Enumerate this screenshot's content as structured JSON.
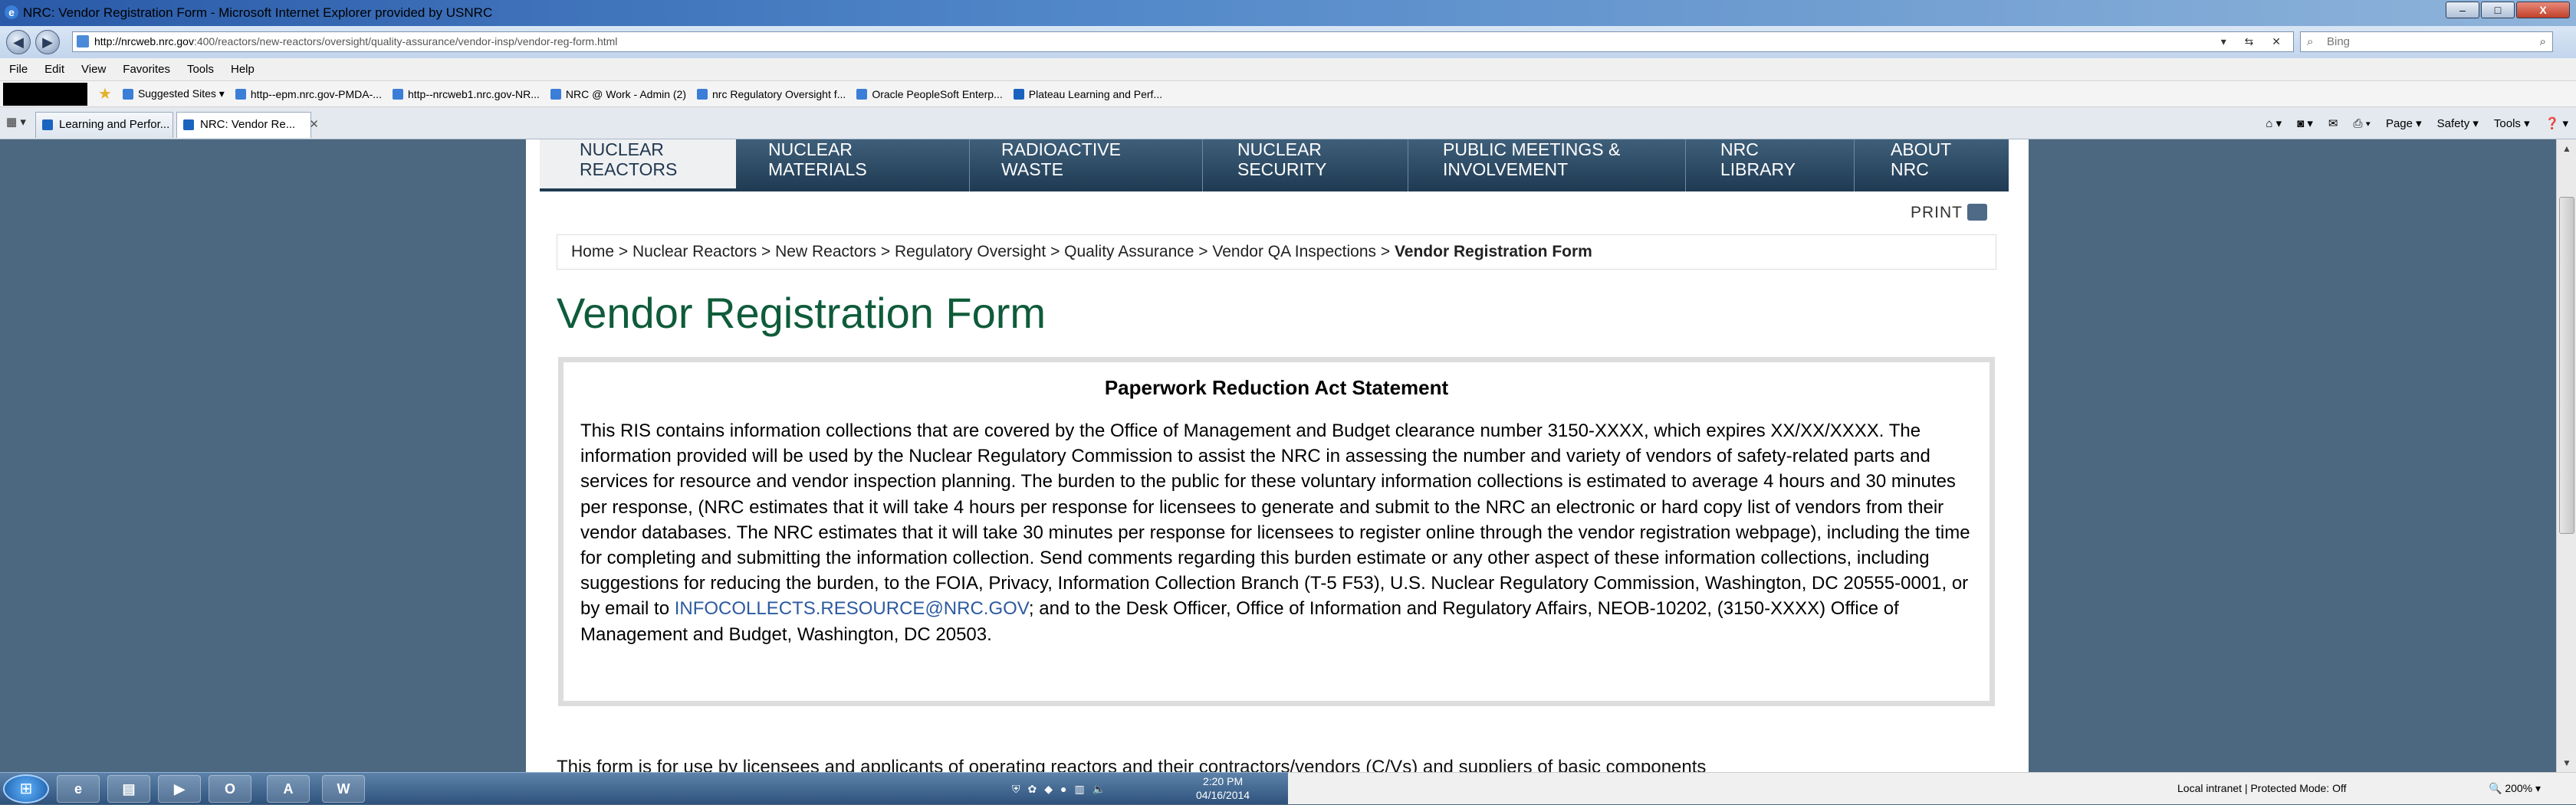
{
  "window": {
    "title": "NRC: Vendor Registration Form - Microsoft Internet Explorer provided by USNRC",
    "minimize": "–",
    "maximize": "□",
    "close": "X"
  },
  "address": {
    "host": "http://nrcweb.nrc.gov",
    "path": ":400/reactors/new-reactors/oversight/quality-assurance/vendor-insp/vendor-reg-form.html",
    "search_placeholder": "Bing"
  },
  "menu": [
    "File",
    "Edit",
    "View",
    "Favorites",
    "Tools",
    "Help"
  ],
  "favorites": [
    "Suggested Sites ▾",
    "http--epm.nrc.gov-PMDA-...",
    "http--nrcweb1.nrc.gov-NR...",
    "NRC @ Work - Admin (2)",
    "nrc Regulatory Oversight f...",
    "Oracle  PeopleSoft Enterp...",
    "Plateau Learning and Perf..."
  ],
  "tabs": [
    {
      "label": "Learning and Perfor..."
    },
    {
      "label": "NRC: Vendor Re...",
      "close": "✕"
    }
  ],
  "commandbar": [
    "Page ▾",
    "Safety ▾",
    "Tools ▾"
  ],
  "site_nav": [
    {
      "line1": "NUCLEAR",
      "line2": "REACTORS"
    },
    {
      "line1": "NUCLEAR",
      "line2": "MATERIALS"
    },
    {
      "line1": "RADIOACTIVE",
      "line2": "WASTE"
    },
    {
      "line1": "NUCLEAR",
      "line2": "SECURITY"
    },
    {
      "line1": "PUBLIC MEETINGS &",
      "line2": "INVOLVEMENT"
    },
    {
      "line1": "NRC",
      "line2": "LIBRARY"
    },
    {
      "line1": "ABOUT",
      "line2": "NRC"
    }
  ],
  "print_label": "PRINT",
  "breadcrumb": {
    "items": [
      "Home",
      "Nuclear Reactors",
      "New Reactors",
      "Regulatory Oversight",
      "Quality Assurance",
      "Vendor QA Inspections"
    ],
    "current": "Vendor Registration Form"
  },
  "page_title": "Vendor Registration Form",
  "pra": {
    "title": "Paperwork Reduction Act Statement",
    "body_before_link": "This RIS contains information collections that are covered by the Office of Management and Budget clearance number 3150-XXXX, which expires XX/XX/XXXX. The information provided will be used by the Nuclear Regulatory Commission to assist the NRC in assessing the number and variety of vendors of safety-related parts and services for resource and vendor inspection planning. The burden to the public for these voluntary information collections is estimated to average 4 hours and 30 minutes per response, (NRC estimates that it will take 4 hours per response for licensees to generate and submit to the NRC an electronic or hard copy list of vendors from their vendor databases. The NRC estimates that it will take 30 minutes per response for licensees to register online through the vendor registration webpage), including the time for completing and submitting the information collection. Send comments regarding this burden estimate or any other aspect of these information collections, including suggestions for reducing the burden, to the FOIA, Privacy, Information Collection Branch (T-5 F53), U.S. Nuclear Regulatory Commission, Washington, DC 20555-0001, or by email to ",
    "email": "INFOCOLLECTS.RESOURCE@NRC.GOV",
    "body_after_link": "; and to the Desk Officer, Office of Information and Regulatory Affairs, NEOB-10202, (3150-XXXX) Office of Management and Budget, Washington, DC 20503."
  },
  "cutoff_text": "This form is for use by licensees and applicants of operating reactors and their contractors/vendors (C/Vs) and suppliers of basic components",
  "taskbar": {
    "time": "2:20 PM",
    "date": "04/16/2014"
  },
  "status": {
    "zone": "Local intranet | Protected Mode: Off",
    "zoom": "200%"
  }
}
